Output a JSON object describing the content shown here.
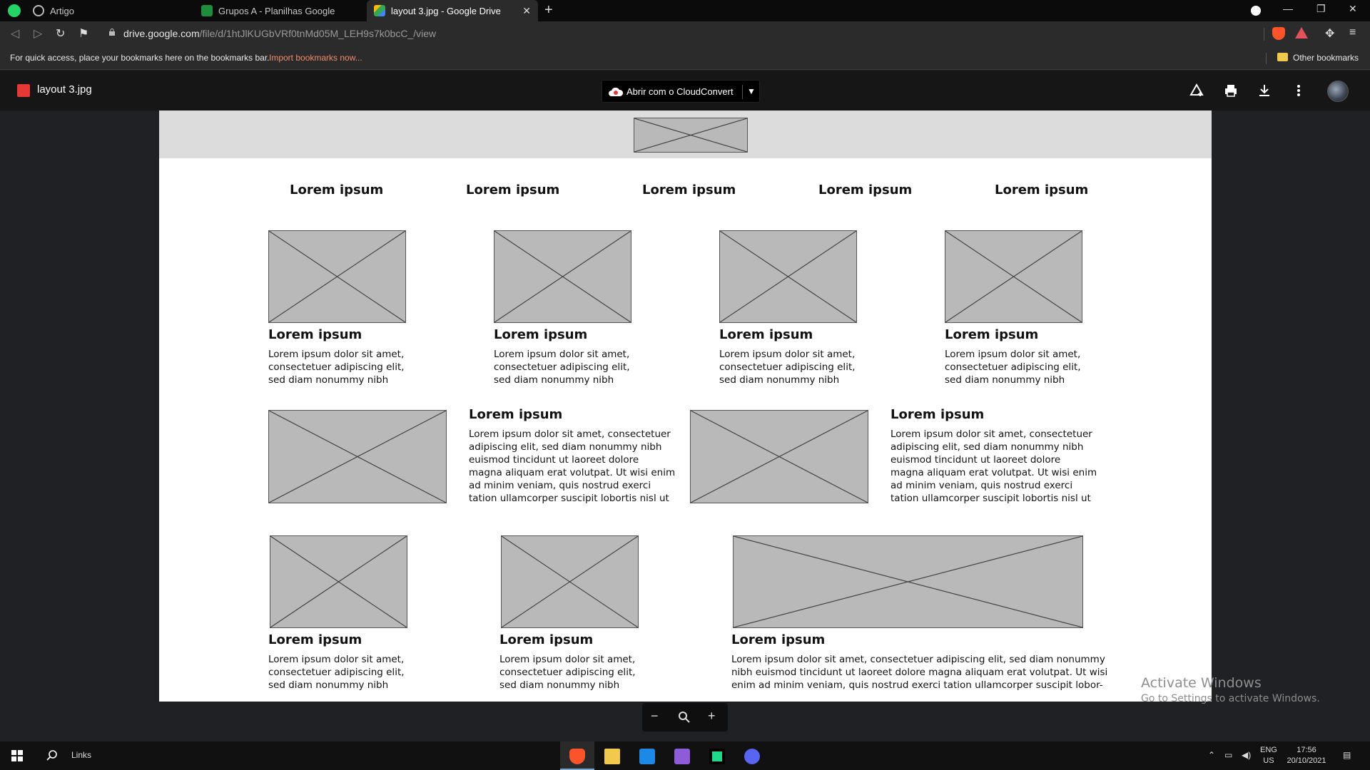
{
  "browser": {
    "tabs": [
      {
        "title": "Artigo",
        "icon": "whatsapp-and-globe-icon",
        "active": false
      },
      {
        "title": "Grupos A - Planilhas Google",
        "icon": "google-sheets-icon",
        "active": false
      },
      {
        "title": "layout 3.jpg - Google Drive",
        "icon": "google-drive-icon",
        "active": true
      }
    ],
    "url_host": "drive.google.com",
    "url_path": "/file/d/1htJlKUGbVRf0tnMd05M_LEH9s7k0bcC_/view",
    "bookmarks_hint": "For quick access, place your bookmarks here on the bookmarks bar.",
    "import_link": "Import bookmarks now...",
    "other_bookmarks": "Other bookmarks"
  },
  "viewer": {
    "file_name": "layout 3.jpg",
    "open_with_label": "Abrir com o CloudConvert"
  },
  "document": {
    "nav_items": [
      "Lorem ipsum",
      "Lorem ipsum",
      "Lorem ipsum",
      "Lorem ipsum",
      "Lorem ipsum"
    ],
    "row1": [
      {
        "title": "Lorem ipsum",
        "text": [
          "Lorem ipsum dolor sit amet,",
          "consectetuer adipiscing elit,",
          "sed diam nonummy nibh"
        ]
      },
      {
        "title": "Lorem ipsum",
        "text": [
          "Lorem ipsum dolor sit amet,",
          "consectetuer adipiscing elit,",
          "sed diam nonummy nibh"
        ]
      },
      {
        "title": "Lorem ipsum",
        "text": [
          "Lorem ipsum dolor sit amet,",
          "consectetuer adipiscing elit,",
          "sed diam nonummy nibh"
        ]
      },
      {
        "title": "Lorem ipsum",
        "text": [
          "Lorem ipsum dolor sit amet,",
          "consectetuer adipiscing elit,",
          "sed diam nonummy nibh"
        ]
      }
    ],
    "row2": [
      {
        "title": "Lorem ipsum",
        "text": [
          "Lorem ipsum dolor sit amet, consectetuer",
          "adipiscing elit, sed diam nonummy nibh",
          "euismod tincidunt ut laoreet dolore",
          "magna aliquam erat volutpat. Ut wisi enim",
          "ad minim veniam, quis nostrud exerci",
          "tation ullamcorper suscipit lobortis nisl ut"
        ]
      },
      {
        "title": "Lorem ipsum",
        "text": [
          "Lorem ipsum dolor sit amet, consectetuer",
          "adipiscing elit, sed diam nonummy nibh",
          "euismod tincidunt ut laoreet dolore",
          "magna aliquam erat volutpat. Ut wisi enim",
          "ad minim veniam, quis nostrud exerci",
          "tation ullamcorper suscipit lobortis nisl ut"
        ]
      }
    ],
    "row3": [
      {
        "title": "Lorem ipsum",
        "text": [
          "Lorem ipsum dolor sit amet,",
          "consectetuer adipiscing elit,",
          "sed diam nonummy nibh"
        ]
      },
      {
        "title": "Lorem ipsum",
        "text": [
          "Lorem ipsum dolor sit amet,",
          "consectetuer adipiscing elit,",
          "sed diam nonummy nibh"
        ]
      },
      {
        "title": "Lorem ipsum",
        "text": [
          "Lorem ipsum dolor sit amet, consectetuer adipiscing elit, sed diam nonummy",
          "nibh euismod tincidunt ut laoreet dolore magna aliquam erat volutpat. Ut wisi",
          "enim ad minim veniam, quis nostrud exerci tation ullamcorper suscipit lobor-"
        ]
      }
    ]
  },
  "zoom": {
    "minus": "−",
    "plus": "+"
  },
  "watermark": {
    "line1": "Activate Windows",
    "line2": "Go to Settings to activate Windows."
  },
  "taskbar": {
    "links_label": "Links",
    "lang_top": "ENG",
    "lang_bottom": "US",
    "time": "17:56",
    "date": "20/10/2021",
    "apps": [
      "brave-browser-icon",
      "file-explorer-icon",
      "vscode-icon",
      "visual-studio-icon",
      "pycharm-icon",
      "discord-icon"
    ]
  },
  "colors": {
    "accent_link": "#f28b6a",
    "placeholder_fill": "#b9b9b9",
    "header_band": "#dcdcdc"
  }
}
